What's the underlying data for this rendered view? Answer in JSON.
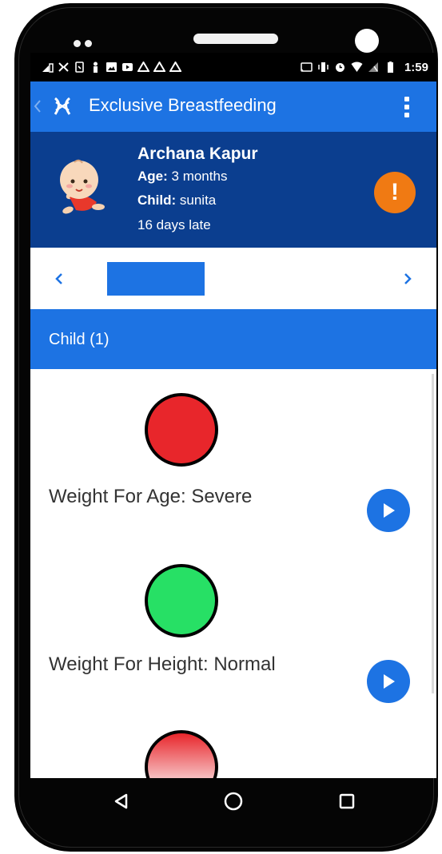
{
  "status_bar": {
    "time": "1:59",
    "icons": [
      "signal-nfc-icon",
      "app-logo-icon",
      "screenshot-icon",
      "person-icon",
      "gallery-icon",
      "youtube-icon",
      "drive-icon",
      "drive-icon",
      "drive-icon",
      "cast-icon",
      "vibrate-icon",
      "alarm-icon",
      "wifi-icon",
      "no-sim-icon",
      "battery-icon"
    ]
  },
  "app_bar": {
    "title": "Exclusive Breastfeeding",
    "color": "#1d73e3"
  },
  "profile": {
    "name": "Archana Kapur",
    "age_label": "Age:",
    "age_value": "3 months",
    "child_label": "Child:",
    "child_value": "sunita",
    "status": "16 days late",
    "alert_symbol": "!",
    "background": "#0b3e8f",
    "alert_color": "#f07a13"
  },
  "pager": {
    "prev_symbol": "‹",
    "next_symbol": "›"
  },
  "section": {
    "title": "Child (1)"
  },
  "metrics": [
    {
      "label": "Weight For Age:",
      "value": "Severe",
      "status_color": "#e8262b"
    },
    {
      "label": "Weight For Height:",
      "value": "Normal",
      "status_color": "#27e065"
    },
    {
      "label": "",
      "value": "",
      "status_color": "#e8262b"
    }
  ]
}
